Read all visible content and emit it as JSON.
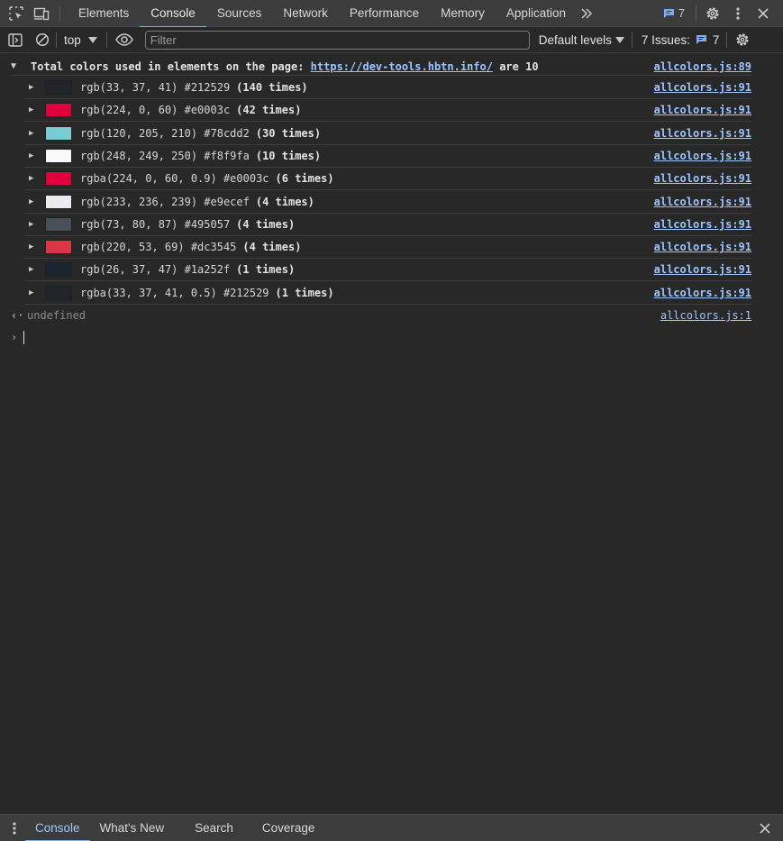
{
  "topbar": {
    "tabs": [
      {
        "label": "Elements"
      },
      {
        "label": "Console"
      },
      {
        "label": "Sources"
      },
      {
        "label": "Network"
      },
      {
        "label": "Performance"
      },
      {
        "label": "Memory"
      },
      {
        "label": "Application"
      }
    ],
    "issues_count": "7",
    "icons": [
      "inspect-element-icon",
      "device-toolbar-icon",
      "more-tabs-icon",
      "settings-gear-icon",
      "more-vertical-icon",
      "close-icon"
    ]
  },
  "toolbar": {
    "context": "top",
    "filter_placeholder": "Filter",
    "levels": "Default levels",
    "issues_label": "7 Issues:",
    "issues_count": "7"
  },
  "console": {
    "group": {
      "prefix": "Total colors used in elements on the page: ",
      "link": "https://dev-tools.hbtn.info/",
      "suffix": " are 10",
      "source": "allcolors.js:89"
    },
    "rows": [
      {
        "text": "rgb(33, 37, 41) #212529",
        "count": "(140 times)",
        "color": "#212529",
        "source": "allcolors.js:91"
      },
      {
        "text": "rgb(224, 0, 60) #e0003c",
        "count": "(42 times)",
        "color": "#e0003c",
        "source": "allcolors.js:91"
      },
      {
        "text": "rgb(120, 205, 210) #78cdd2",
        "count": "(30 times)",
        "color": "#78cdd2",
        "source": "allcolors.js:91"
      },
      {
        "text": "rgb(248, 249, 250) #f8f9fa",
        "count": "(10 times)",
        "color": "#f8f9fa",
        "source": "allcolors.js:91"
      },
      {
        "text": "rgba(224, 0, 60, 0.9) #e0003c",
        "count": "(6 times)",
        "color": "#e0003c",
        "source": "allcolors.js:91"
      },
      {
        "text": "rgb(233, 236, 239) #e9ecef",
        "count": "(4 times)",
        "color": "#e9ecef",
        "source": "allcolors.js:91"
      },
      {
        "text": "rgb(73, 80, 87) #495057",
        "count": "(4 times)",
        "color": "#495057",
        "source": "allcolors.js:91"
      },
      {
        "text": "rgb(220, 53, 69) #dc3545",
        "count": "(4 times)",
        "color": "#dc3545",
        "source": "allcolors.js:91"
      },
      {
        "text": "rgb(26, 37, 47) #1a252f",
        "count": "(1 times)",
        "color": "#1a252f",
        "source": "allcolors.js:91"
      },
      {
        "text": "rgba(33, 37, 41, 0.5) #212529",
        "count": "(1 times)",
        "color": "#212529",
        "source": "allcolors.js:91"
      }
    ],
    "result": {
      "value": "undefined",
      "source": "allcolors.js:1"
    }
  },
  "drawer": {
    "tabs": [
      {
        "label": "Console"
      },
      {
        "label": "What's New"
      },
      {
        "label": "Search"
      },
      {
        "label": "Coverage"
      }
    ]
  },
  "colors": {
    "accent": "#7cacf8",
    "link": "#9ec5fe",
    "background": "#282828",
    "panel": "#3c3c3c"
  }
}
